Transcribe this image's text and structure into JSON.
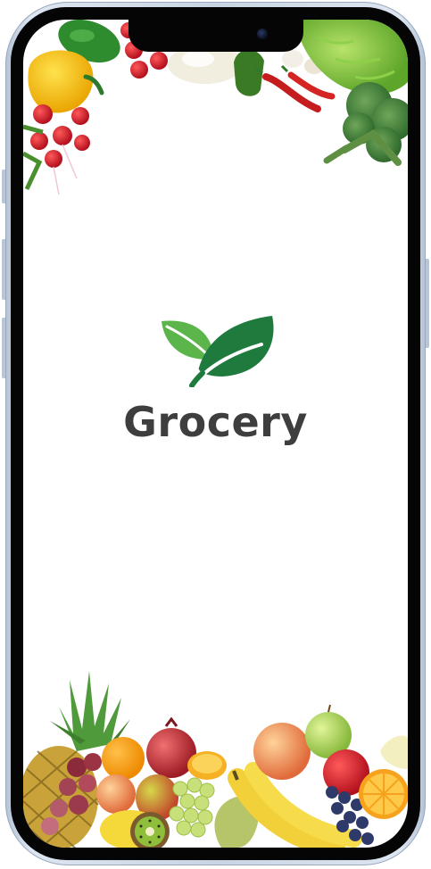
{
  "app": {
    "brand_name": "Grocery"
  },
  "colors": {
    "brand_text": "#3e3e3e",
    "leaf_light": "#5bb54a",
    "leaf_dark": "#1f7a3e",
    "background": "#ffffff"
  },
  "icons": {
    "logo": "leaf-icon",
    "decor_top": "vegetables-border",
    "decor_bottom": "fruits-border"
  }
}
